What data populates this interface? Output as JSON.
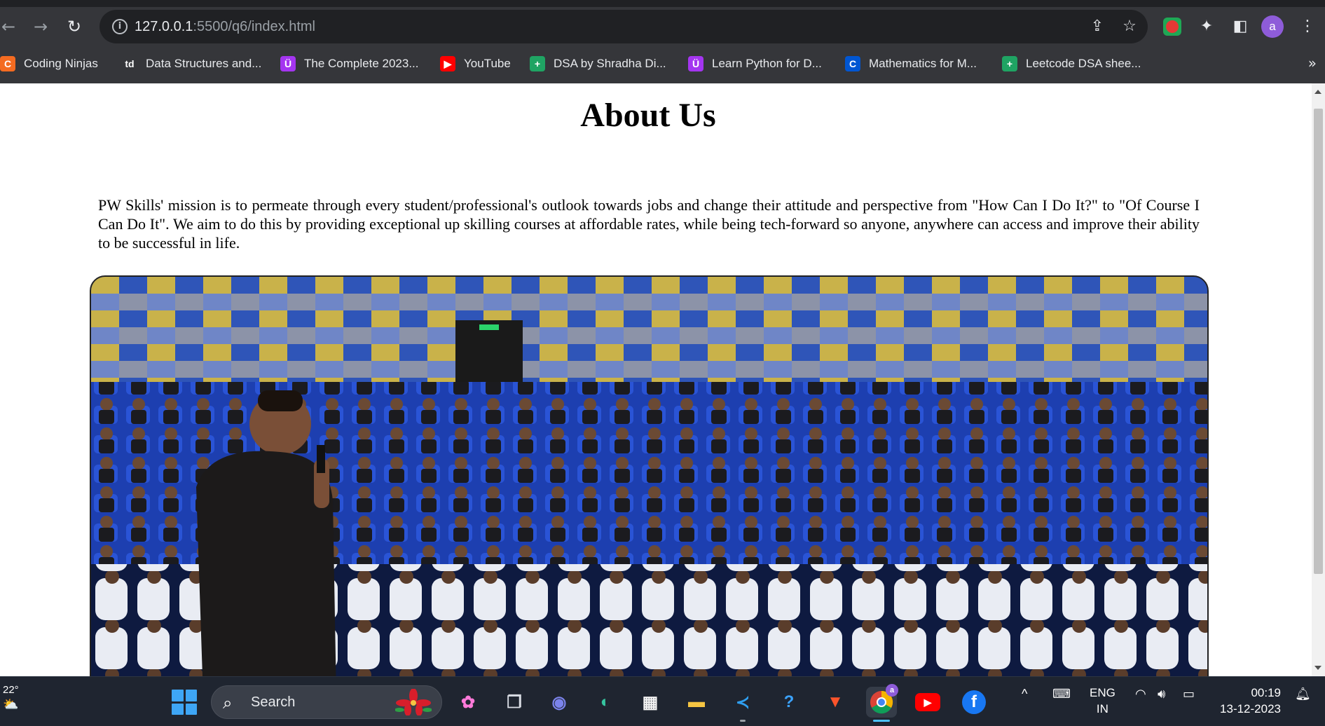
{
  "browser": {
    "url_host": "127.0.0.1",
    "url_path": ":5500/q6/index.html",
    "avatar_letter": "a"
  },
  "bookmarks": [
    {
      "label": "Coding Ninjas",
      "icon": "coding-ninjas-icon",
      "color": "#f46b21",
      "glyph": "C"
    },
    {
      "label": "Data Structures and...",
      "icon": "td-icon",
      "color": "#35363a",
      "glyph": "td"
    },
    {
      "label": "The Complete 2023...",
      "icon": "udemy-icon",
      "color": "#a435f0",
      "glyph": "Ü"
    },
    {
      "label": "YouTube",
      "icon": "youtube-icon",
      "color": "#ff0000",
      "glyph": "▶"
    },
    {
      "label": "DSA by Shradha Di...",
      "icon": "sheets-icon",
      "color": "#1fa463",
      "glyph": "+"
    },
    {
      "label": "Learn Python for D...",
      "icon": "udemy-icon",
      "color": "#a435f0",
      "glyph": "Ü"
    },
    {
      "label": "Mathematics for M...",
      "icon": "coursera-icon",
      "color": "#0056d2",
      "glyph": "C"
    },
    {
      "label": "Leetcode DSA shee...",
      "icon": "sheets-icon",
      "color": "#1fa463",
      "glyph": "+"
    }
  ],
  "page": {
    "title": "About Us",
    "mission": "PW Skills' mission is to permeate through every student/professional's outlook towards jobs and change their attitude and perspective from \"How Can I Do It?\" to \"Of Course I Can Do It\". We aim to do this by providing exceptional up skilling courses at affordable rates, while being tech-forward so anyone, anywhere can access and improve their ability to be successful in life."
  },
  "taskbar": {
    "weather_temp": "22°",
    "search_label": "Search",
    "language_line1": "ENG",
    "language_line2": "IN",
    "time": "00:19",
    "date": "13-12-2023",
    "chrome_badge": "a"
  }
}
